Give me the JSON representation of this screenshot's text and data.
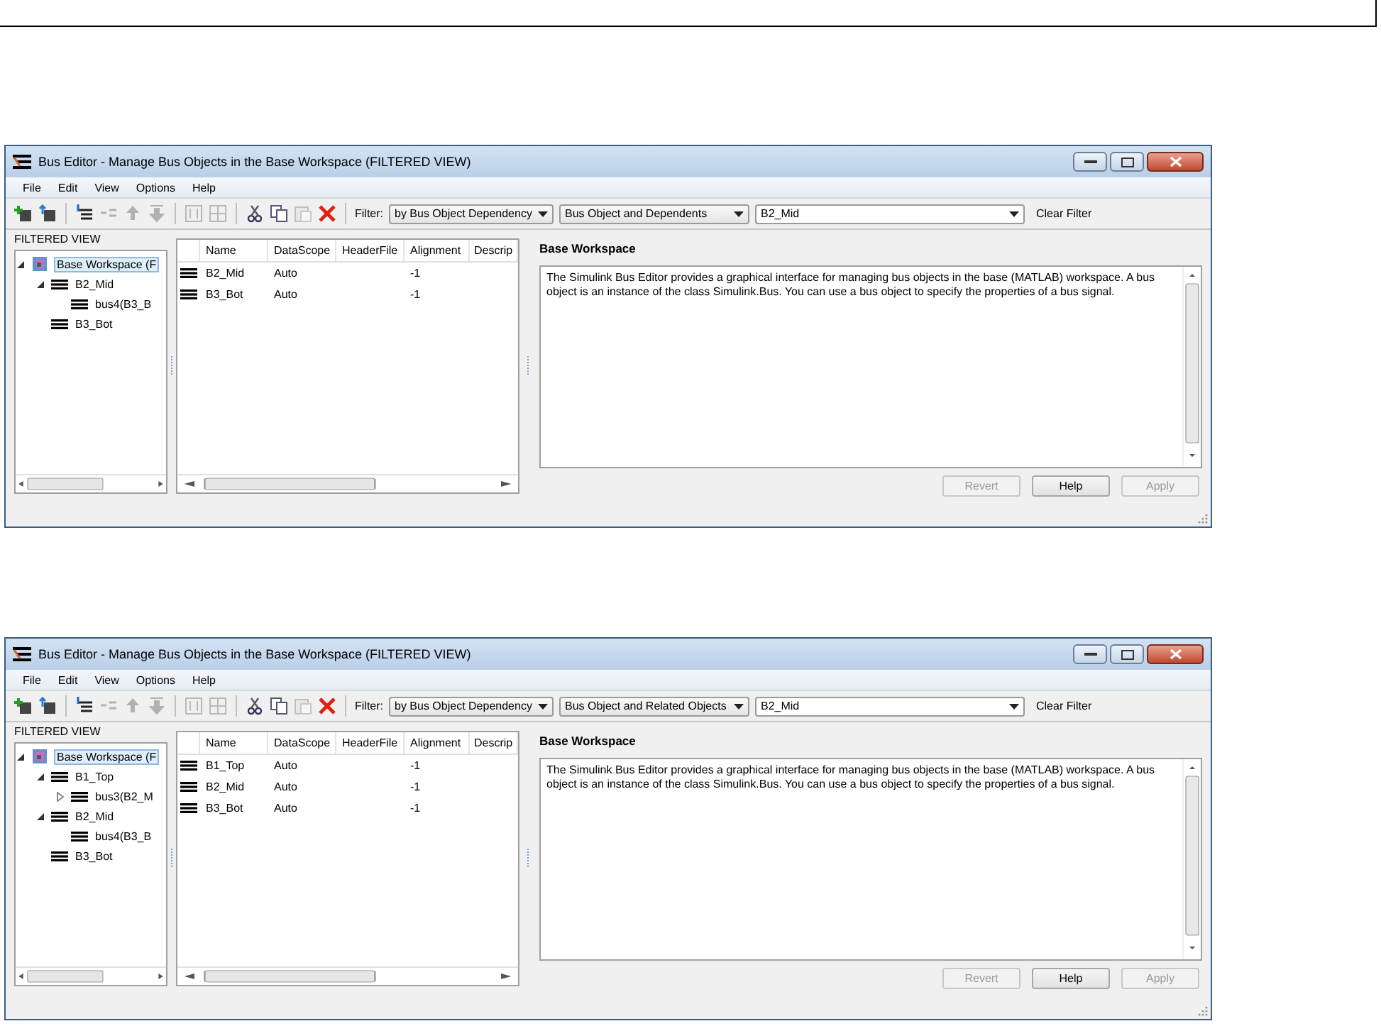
{
  "windows": [
    {
      "title": "Bus Editor - Manage Bus Objects in the Base Workspace (FILTERED VIEW)",
      "menu": [
        "File",
        "Edit",
        "View",
        "Options",
        "Help"
      ],
      "filter_label": "Filter:",
      "filter_by": "by Bus Object Dependency",
      "filter_scope": "Bus Object and Dependents",
      "filter_value": "B2_Mid",
      "clear_filter": "Clear Filter",
      "tree_header": "FILTERED VIEW",
      "tree": [
        {
          "label": "Base Workspace (F",
          "kind": "workspace",
          "selected": true,
          "expanded": true,
          "children": [
            {
              "label": "B2_Mid",
              "kind": "bus",
              "selected": false,
              "expanded": true,
              "children": [
                {
                  "label": "bus4(B3_B",
                  "kind": "bus",
                  "selected": false
                }
              ]
            },
            {
              "label": "B3_Bot",
              "kind": "bus",
              "selected": false
            }
          ]
        }
      ],
      "columns": [
        "Name",
        "DataScope",
        "HeaderFile",
        "Alignment",
        "Descrip"
      ],
      "rows": [
        {
          "name": "B2_Mid",
          "data_scope": "Auto",
          "alignment": "-1"
        },
        {
          "name": "B3_Bot",
          "data_scope": "Auto",
          "alignment": "-1"
        }
      ],
      "detail_title": "Base Workspace",
      "description": "The Simulink Bus Editor provides a graphical interface for managing bus objects in the base (MATLAB) workspace. A bus object is an instance of the class Simulink.Bus. You can use a bus object to specify the properties of a bus signal.",
      "buttons": [
        {
          "label": "Revert",
          "disabled": true
        },
        {
          "label": "Help",
          "disabled": false
        },
        {
          "label": "Apply",
          "disabled": true
        }
      ]
    },
    {
      "title": "Bus Editor - Manage Bus Objects in the Base Workspace (FILTERED VIEW)",
      "menu": [
        "File",
        "Edit",
        "View",
        "Options",
        "Help"
      ],
      "filter_label": "Filter:",
      "filter_by": "by Bus Object Dependency",
      "filter_scope": "Bus Object and Related Objects",
      "filter_value": "B2_Mid",
      "clear_filter": "Clear Filter",
      "tree_header": "FILTERED VIEW",
      "tree": [
        {
          "label": "Base Workspace (F",
          "kind": "workspace",
          "selected": true,
          "expanded": true,
          "children": [
            {
              "label": "B1_Top",
              "kind": "bus",
              "selected": false,
              "expanded": true,
              "children": [
                {
                  "label": "bus3(B2_M",
                  "kind": "bus",
                  "selected": false,
                  "expanded": false
                }
              ]
            },
            {
              "label": "B2_Mid",
              "kind": "bus",
              "selected": false,
              "expanded": true,
              "children": [
                {
                  "label": "bus4(B3_B",
                  "kind": "bus",
                  "selected": false
                }
              ]
            },
            {
              "label": "B3_Bot",
              "kind": "bus",
              "selected": false
            }
          ]
        }
      ],
      "columns": [
        "Name",
        "DataScope",
        "HeaderFile",
        "Alignment",
        "Descrip"
      ],
      "rows": [
        {
          "name": "B1_Top",
          "data_scope": "Auto",
          "alignment": "-1"
        },
        {
          "name": "B2_Mid",
          "data_scope": "Auto",
          "alignment": "-1"
        },
        {
          "name": "B3_Bot",
          "data_scope": "Auto",
          "alignment": "-1"
        }
      ],
      "detail_title": "Base Workspace",
      "description": "The Simulink Bus Editor provides a graphical interface for managing bus objects in the base (MATLAB) workspace. A bus object is an instance of the class Simulink.Bus. You can use a bus object to specify the properties of a bus signal.",
      "buttons": [
        {
          "label": "Revert",
          "disabled": true
        },
        {
          "label": "Help",
          "disabled": false
        },
        {
          "label": "Apply",
          "disabled": true
        }
      ]
    }
  ]
}
